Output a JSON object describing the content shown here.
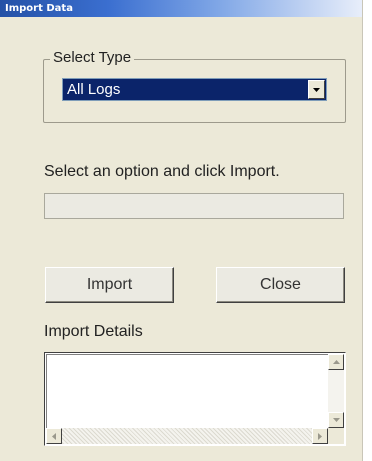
{
  "window": {
    "title": "Import Data"
  },
  "select_type": {
    "legend": "Select Type",
    "selected": "All Logs"
  },
  "instructions": "Select an option and click Import.",
  "progress": {
    "value": 0
  },
  "buttons": {
    "import_label": "Import",
    "close_label": "Close"
  },
  "details": {
    "label": "Import Details",
    "text": ""
  },
  "colors": {
    "titlebar_start": "#2451a6",
    "window_bg": "#ece9d8",
    "selection_bg": "#0b246a"
  }
}
